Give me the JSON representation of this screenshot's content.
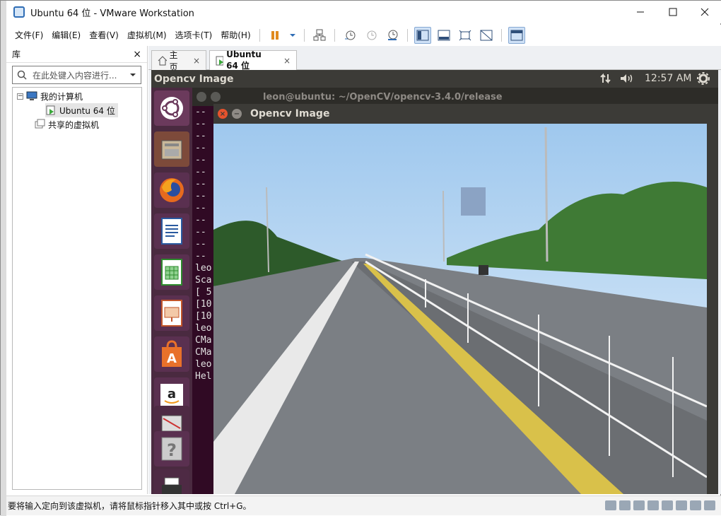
{
  "window": {
    "title": "Ubuntu 64 位 - VMware Workstation"
  },
  "menu": {
    "items": [
      "文件(F)",
      "编辑(E)",
      "查看(V)",
      "虚拟机(M)",
      "选项卡(T)",
      "帮助(H)"
    ]
  },
  "library": {
    "title": "库",
    "close": "×",
    "search_placeholder": "在此处键入内容进行...",
    "tree": {
      "my_computer": "我的计算机",
      "vm": "Ubuntu 64 位",
      "shared": "共享的虚拟机"
    }
  },
  "tabs": [
    {
      "label": "主页",
      "close": "×"
    },
    {
      "label": "Ubuntu 64 位",
      "close": "×"
    }
  ],
  "ubuntu": {
    "topbar_title": "Opencv Image",
    "clock": "12:57 AM",
    "terminal_title": "leon@ubuntu: ~/OpenCV/opencv-3.4.0/release",
    "terminal_lines": "--\n--\n--\n--\n--\n--\n--\n--\n--\n--\n--\n--\n--\nleo\nSca\n[ 5\n[10\n[10\nleo\nCMa\nCMa\nleo\nHel",
    "cv_window_title": "Opencv Image"
  },
  "status": {
    "text": "要将输入定向到该虚拟机，请将鼠标指针移入其中或按 Ctrl+G。"
  },
  "colors": {
    "ubuntu_bg": "#300a24",
    "ubuntu_panel": "#3c3b37",
    "accent": "#2f6db5"
  }
}
